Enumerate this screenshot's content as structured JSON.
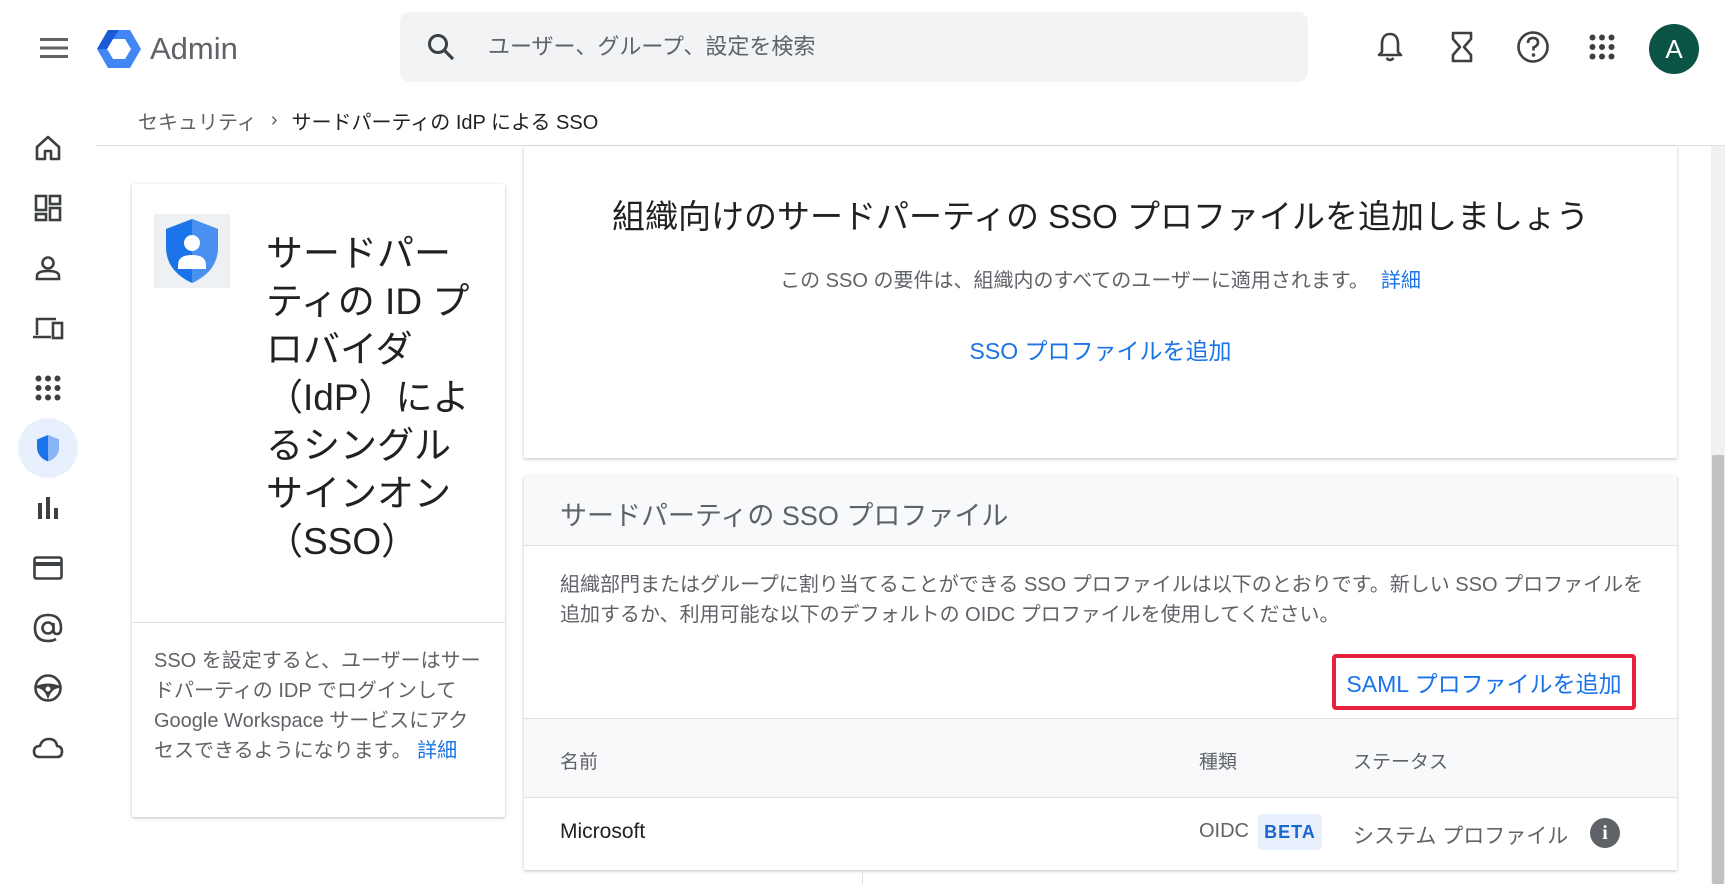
{
  "header": {
    "app_name": "Admin",
    "search_placeholder": "ユーザー、グループ、設定を検索",
    "avatar_letter": "A",
    "icons": [
      "menu-icon",
      "bell-icon",
      "hourglass-icon",
      "help-icon",
      "apps-grid-icon"
    ]
  },
  "breadcrumb": {
    "parent": "セキュリティ",
    "separator": "›",
    "current": "サードパーティの IdP による SSO"
  },
  "sidenav": {
    "items": [
      "home",
      "dashboard",
      "users",
      "devices",
      "apps",
      "security",
      "reports",
      "billing",
      "account",
      "rules",
      "storage"
    ],
    "active": "security"
  },
  "info_card": {
    "title": "サードパーティの ID プロバイダ（IdP）によるシングル サインオン（SSO）",
    "description": "SSO を設定すると、ユーザーはサードパーティの IDP でログインして Google Workspace サービスにアクセスできるようになります。",
    "link": "詳細"
  },
  "top_card": {
    "title": "組織向けのサードパーティの SSO プロファイルを追加しましょう",
    "subtitle": "この SSO の要件は、組織内のすべてのユーザーに適用されます。",
    "subtitle_link": "詳細",
    "action": "SSO プロファイルを追加"
  },
  "profiles_card": {
    "title": "サードパーティの SSO プロファイル",
    "description": "組織部門またはグループに割り当てることができる SSO プロファイルは以下のとおりです。新しい SSO プロファイルを追加するか、利用可能な以下のデフォルトの OIDC プロファイルを使用してください。",
    "add_saml": "SAML プロファイルを追加",
    "columns": {
      "name": "名前",
      "type": "種類",
      "status": "ステータス"
    },
    "rows": [
      {
        "name": "Microsoft",
        "type": "OIDC",
        "badge": "BETA",
        "status": "システム プロファイル",
        "info": "i"
      }
    ]
  },
  "colors": {
    "accent": "#1a73e8",
    "highlight": "#e8203c",
    "avatar_bg": "#0b5345"
  }
}
